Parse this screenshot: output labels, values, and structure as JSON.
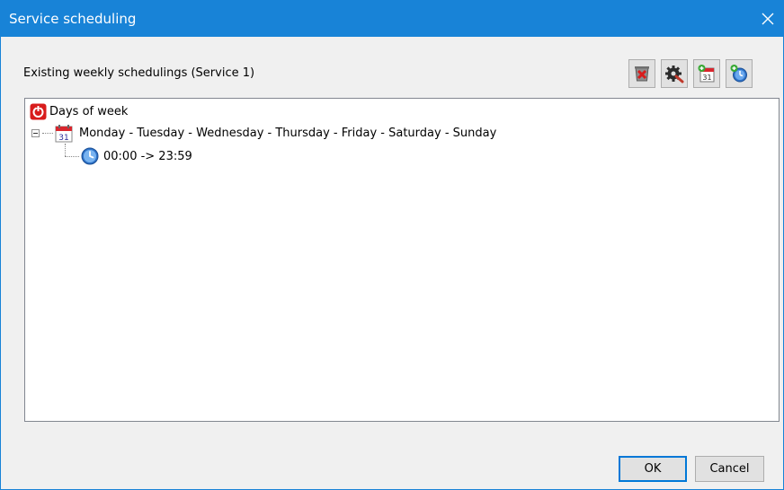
{
  "window": {
    "title": "Service scheduling"
  },
  "section": {
    "label": "Existing weekly schedulings (Service 1)"
  },
  "toolbar": {
    "buttons": [
      {
        "icon": "delete-icon"
      },
      {
        "icon": "settings-icon"
      },
      {
        "icon": "add-day-icon"
      },
      {
        "icon": "add-time-icon"
      }
    ]
  },
  "tree": {
    "root": {
      "label": "Days of week",
      "icon": "days-of-week-icon"
    },
    "days": {
      "label": "Monday - Tuesday - Wednesday - Thursday - Friday - Saturday - Sunday",
      "icon": "calendar-icon",
      "expanded": true
    },
    "time": {
      "label": "00:00 -> 23:59",
      "icon": "clock-icon"
    }
  },
  "buttons": {
    "ok": "OK",
    "cancel": "Cancel"
  },
  "colors": {
    "titlebar": "#1883d7",
    "accent": "#0078d7"
  }
}
